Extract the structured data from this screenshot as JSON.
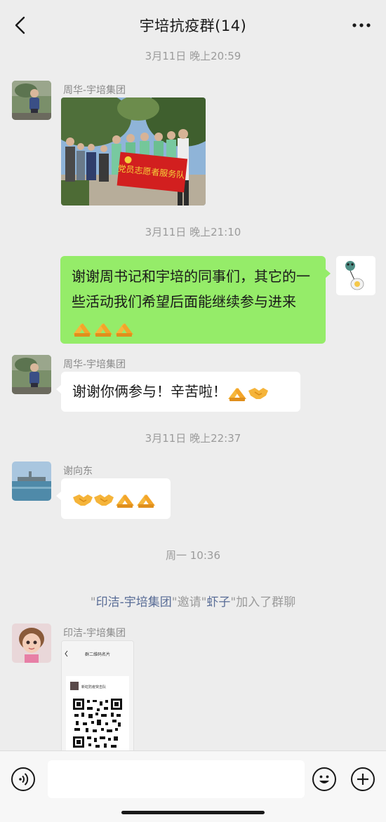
{
  "header": {
    "title": "宇培抗疫群(14)"
  },
  "timestamps": [
    "3月11日 晚上20:59",
    "3月11日 晚上21:10",
    "3月11日 晚上22:37",
    "周一 10:36"
  ],
  "messages": [
    {
      "sender": "周华-宇培集团"
    },
    {
      "text": "谢谢周书记和宇培的同事们，其它的一些活动我们希望后面能继续参与进来"
    },
    {
      "sender": "周华-宇培集团",
      "text": "谢谢你俩参与！辛苦啦！"
    },
    {
      "sender": "谢向东"
    },
    {
      "sender": "印洁-宇培集团"
    }
  ],
  "system": {
    "q1": "\"",
    "name1": "印洁-宇培集团",
    "mid": "\"邀请\"",
    "name2": "虾子",
    "tail": "\"加入了群聊"
  },
  "photo": {
    "banner_text": "党员志愿者服务队"
  },
  "qr_card": {
    "title": "群二维码名片",
    "group": "新虹防疫突击队"
  },
  "icons": [
    "back-icon",
    "more-icon",
    "voice-icon",
    "emoji-icon",
    "plus-icon",
    "folded-hands-emoji",
    "handshake-emoji"
  ],
  "colors": {
    "bg": "#ededed",
    "mine_bubble": "#95ec69",
    "bubble": "#ffffff",
    "link": "#576b95"
  }
}
